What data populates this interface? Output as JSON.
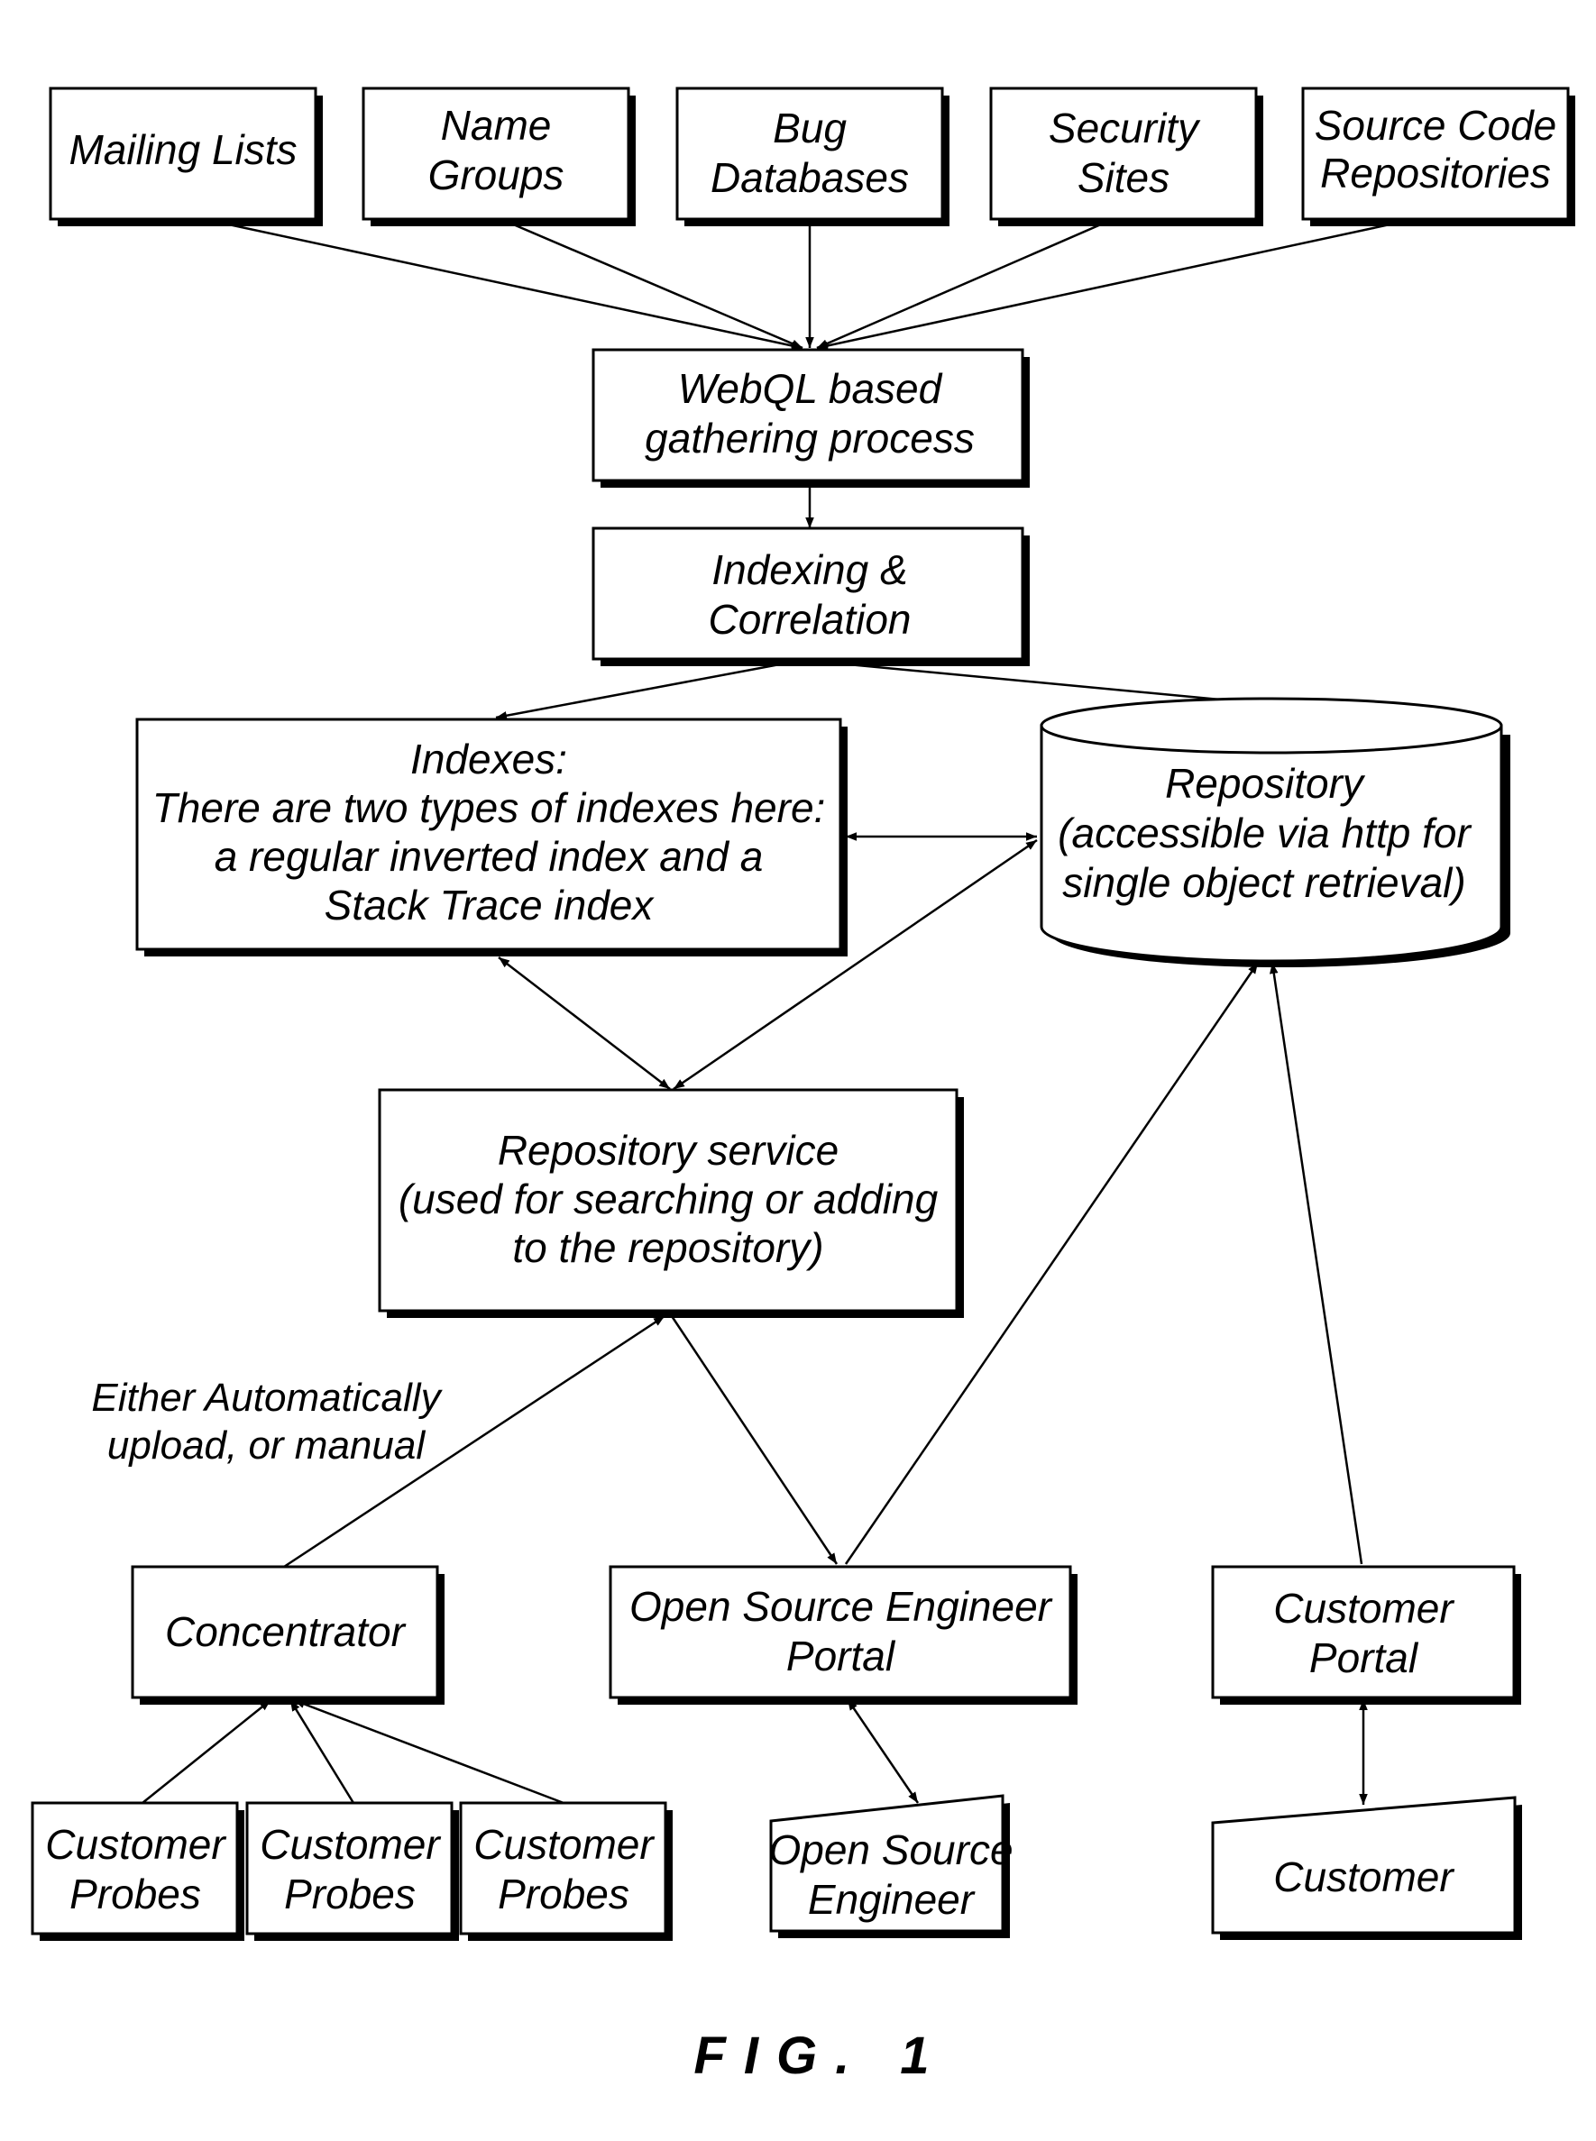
{
  "diagram": {
    "sources": [
      {
        "id": "mailing-lists",
        "lines": [
          "Mailing Lists"
        ]
      },
      {
        "id": "name-groups",
        "lines": [
          "Name",
          "Groups"
        ]
      },
      {
        "id": "bug-databases",
        "lines": [
          "Bug",
          "Databases"
        ]
      },
      {
        "id": "security-sites",
        "lines": [
          "Security",
          "Sites"
        ]
      },
      {
        "id": "source-code-repositories",
        "lines": [
          "Source Code",
          "Repositories"
        ]
      }
    ],
    "webql": {
      "lines": [
        "WebQL based",
        "gathering process"
      ]
    },
    "indexing": {
      "lines": [
        "Indexing &",
        "Correlation"
      ]
    },
    "indexes": {
      "lines": [
        "Indexes:",
        "There are two types of indexes here:",
        "a regular inverted index and a",
        "Stack Trace index"
      ]
    },
    "repository": {
      "lines": [
        "Repository",
        "(accessible via http for",
        "single object retrieval)"
      ]
    },
    "repository_service": {
      "lines": [
        "Repository service",
        "(used for searching or adding",
        "to the repository)"
      ]
    },
    "upload_note": {
      "lines": [
        "Either Automatically",
        "upload, or manual"
      ]
    },
    "concentrator": {
      "lines": [
        "Concentrator"
      ]
    },
    "os_engineer_portal": {
      "lines": [
        "Open Source Engineer",
        "Portal"
      ]
    },
    "customer_portal": {
      "lines": [
        "Customer",
        "Portal"
      ]
    },
    "probes": [
      {
        "lines": [
          "Customer",
          "Probes"
        ]
      },
      {
        "lines": [
          "Customer",
          "Probes"
        ]
      },
      {
        "lines": [
          "Customer",
          "Probes"
        ]
      }
    ],
    "os_engineer": {
      "lines": [
        "Open Source",
        "Engineer"
      ]
    },
    "customer": {
      "lines": [
        "Customer"
      ]
    },
    "figure_label": "FIG. 1",
    "edges": [
      {
        "from": "mailing-lists",
        "to": "webql",
        "direction": "forward"
      },
      {
        "from": "name-groups",
        "to": "webql",
        "direction": "forward"
      },
      {
        "from": "bug-databases",
        "to": "webql",
        "direction": "forward"
      },
      {
        "from": "security-sites",
        "to": "webql",
        "direction": "forward"
      },
      {
        "from": "source-code-repositories",
        "to": "webql",
        "direction": "forward"
      },
      {
        "from": "webql",
        "to": "indexing",
        "direction": "forward"
      },
      {
        "from": "indexing",
        "to": "indexes",
        "direction": "forward"
      },
      {
        "from": "indexing",
        "to": "repository",
        "direction": "forward"
      },
      {
        "from": "indexes",
        "to": "repository",
        "direction": "both"
      },
      {
        "from": "indexes",
        "to": "repository-service",
        "direction": "both"
      },
      {
        "from": "repository",
        "to": "repository-service",
        "direction": "both"
      },
      {
        "from": "concentrator",
        "to": "repository-service",
        "direction": "forward"
      },
      {
        "from": "repository-service",
        "to": "os-engineer-portal",
        "direction": "forward"
      },
      {
        "from": "os-engineer-portal",
        "to": "repository",
        "direction": "forward"
      },
      {
        "from": "customer-portal",
        "to": "repository",
        "direction": "forward"
      },
      {
        "from": "probe-1",
        "to": "concentrator",
        "direction": "forward"
      },
      {
        "from": "probe-2",
        "to": "concentrator",
        "direction": "forward"
      },
      {
        "from": "probe-3",
        "to": "concentrator",
        "direction": "forward"
      },
      {
        "from": "os-engineer-portal",
        "to": "os-engineer",
        "direction": "both"
      },
      {
        "from": "customer-portal",
        "to": "customer",
        "direction": "both"
      }
    ]
  }
}
